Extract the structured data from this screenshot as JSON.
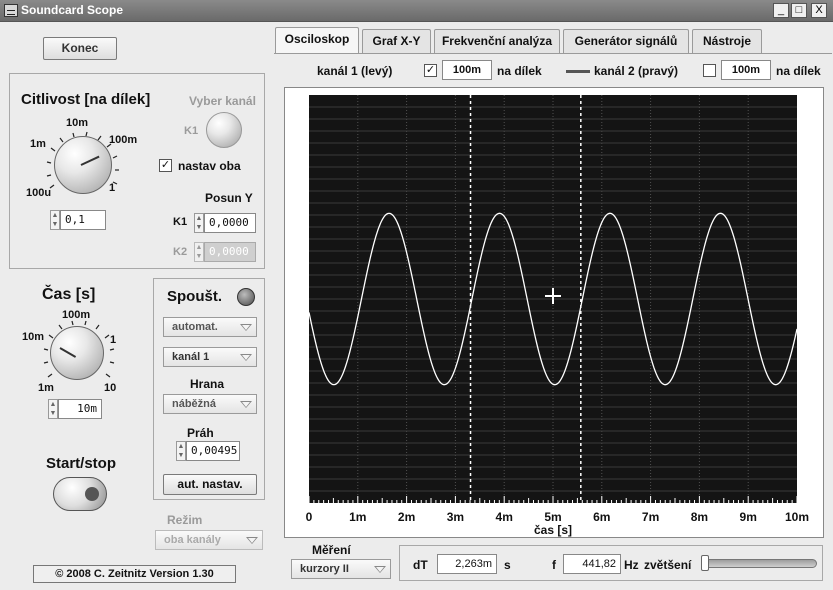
{
  "window": {
    "title": "Soundcard Scope",
    "minimize": "_",
    "maximize": "□",
    "close": "X"
  },
  "left": {
    "quit_label": "Konec",
    "sensitivity": {
      "title": "Citlivost [na dílek]",
      "scale": [
        "100u",
        "1m",
        "10m",
        "100m",
        "1"
      ],
      "value": "0,1",
      "select_channel_label": "Vyber kanál",
      "k1_label": "K1",
      "both_label": "nastav oba",
      "both_checked": "✓",
      "offset_title": "Posun Y",
      "k1_offset": "0,0000",
      "k2_label": "K2",
      "k2_offset": "0,0000"
    },
    "time": {
      "title": "Čas [s]",
      "scale": [
        "1m",
        "10m",
        "100m",
        "1",
        "10"
      ],
      "value": "10m"
    },
    "trigger": {
      "title": "Spoušt.",
      "mode": "automat.",
      "channel": "kanál 1",
      "edge_label": "Hrana",
      "edge": "náběžná",
      "threshold_label": "Práh",
      "threshold": "0,00495",
      "auto_button": "aut. nastav."
    },
    "start_stop_label": "Start/stop",
    "mode_label": "Režim",
    "mode_value": "oba kanály",
    "footer": "© 2008  C. Zeitnitz Version 1.30"
  },
  "tabs": [
    "Osciloskop",
    "Graf X-Y",
    "Frekvenční analýza",
    "Generátor signálů",
    "Nástroje"
  ],
  "channels": {
    "ch1_label": "kanál 1 (levý)",
    "ch1_checked": "✓",
    "ch1_value": "100m",
    "per_div": "na dílek",
    "ch2_label": "kanál 2 (pravý)",
    "ch2_checked": "",
    "ch2_value": "100m"
  },
  "chart_data": {
    "type": "line",
    "xlabel": "čas [s]",
    "x_ticks": [
      "0",
      "1m",
      "2m",
      "3m",
      "4m",
      "5m",
      "6m",
      "7m",
      "8m",
      "9m",
      "10m"
    ],
    "xlim": [
      0,
      0.01
    ],
    "series": [
      {
        "frequency_hz": 441.82,
        "color": "#ffffff"
      }
    ],
    "cursors_s": [
      0.00331,
      0.00557
    ],
    "background": "#141414",
    "grid": true
  },
  "measure": {
    "label": "Měření",
    "mode": "kurzory II",
    "dT_label": "dT",
    "dT": "2,263m",
    "dT_unit": "s",
    "f_label": "f",
    "f": "441,82",
    "f_unit": "Hz",
    "zoom_label": "zvětšení"
  }
}
